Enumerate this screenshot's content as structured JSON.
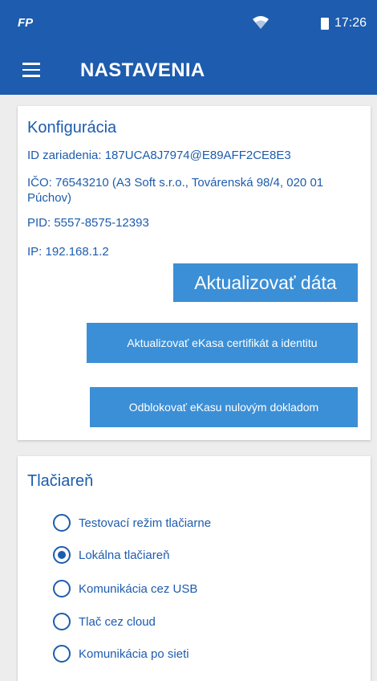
{
  "status_bar": {
    "app_glyph": "FP",
    "time": "17:26"
  },
  "app_bar": {
    "title": "NASTAVENIA"
  },
  "config": {
    "heading": "Konfigurácia",
    "device_id": "ID zariadenia: 187UCA8J7974@E89AFF2CE8E3",
    "ico": "IČO: 76543210 (A3 Soft s.r.o., Továrenská 98/4, 020 01 Púchov)",
    "pid": "PID: 5557-8575-12393",
    "ip": "IP: 192.168.1.2",
    "update_data_label": "Aktualizovať dáta",
    "update_cert_label": "Aktualizovať eKasa certifikát a identitu",
    "unblock_label": "Odblokovať eKasu nulovým dokladom"
  },
  "printer": {
    "heading": "Tlačiareň",
    "options": [
      {
        "label": "Testovací režim tlačiarne",
        "checked": false
      },
      {
        "label": "Lokálna tlačiareň",
        "checked": true
      },
      {
        "label": "Komunikácia cez USB",
        "checked": false
      },
      {
        "label": "Tlač cez cloud",
        "checked": false
      },
      {
        "label": "Komunikácia po sieti",
        "checked": false
      }
    ]
  },
  "colors": {
    "primary": "#1d5cae",
    "button": "#3b8fd6",
    "background": "#ededed"
  }
}
